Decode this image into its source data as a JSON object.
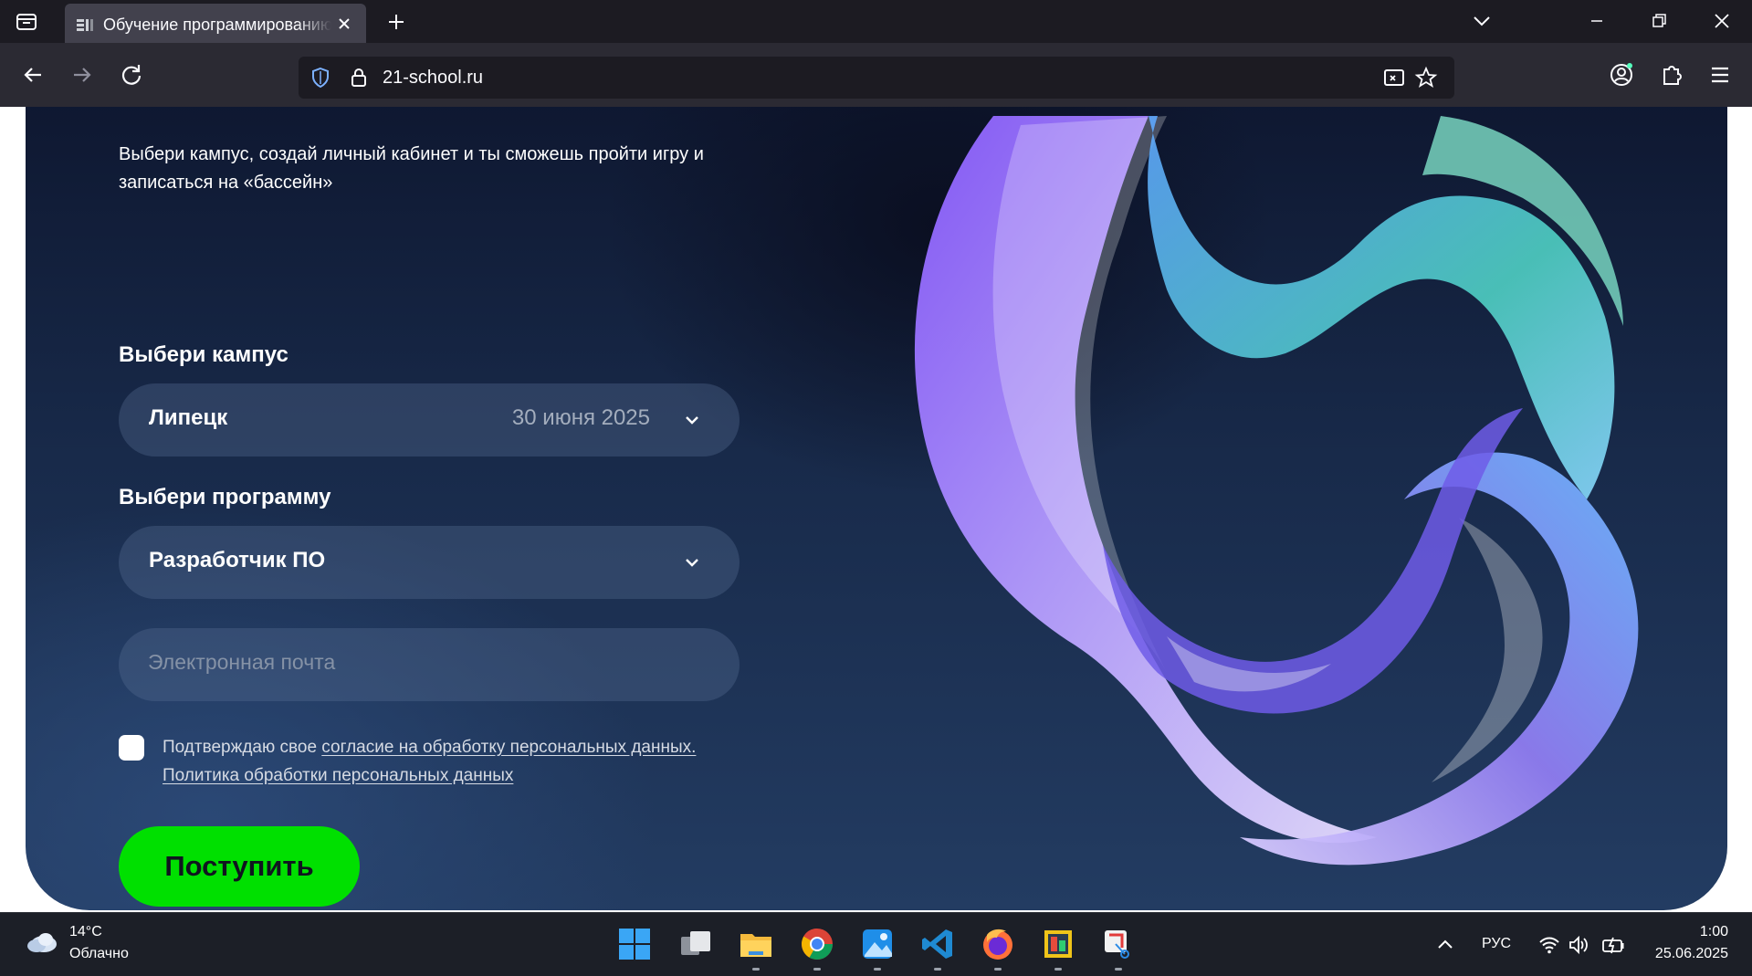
{
  "browser": {
    "tab_title": "Обучение программированию",
    "url": "21-school.ru"
  },
  "page": {
    "intro": "Выбери кампус, создай личный кабинет и ты сможешь пройти игру и записаться на «бассейн»",
    "campus_label": "Выбери кампус",
    "campus_value": "Липецк",
    "campus_date": "30 июня 2025",
    "program_label": "Выбери программу",
    "program_value": "Разработчик ПО",
    "email_placeholder": "Электронная почта",
    "consent_prefix": "Подтверждаю свое ",
    "consent_link": "согласие на обработку персональных данных.",
    "policy_link": "Политика обработки персональных данных",
    "submit_label": "Поступить",
    "checkbox_checked": false
  },
  "color_chip": {
    "hex_label": "273f60",
    "color": "#273f60"
  },
  "colors": {
    "accent_green": "#00e000",
    "page_bg": "#1a2d4c"
  },
  "taskbar": {
    "weather_temp": "14°C",
    "weather_desc": "Облачно",
    "apps": [
      "start-icon",
      "task-view-icon",
      "file-explorer-icon",
      "chrome-icon",
      "photos-icon",
      "vscode-icon",
      "firefox-icon",
      "app-icon",
      "snipping-tool-icon"
    ],
    "language": "РУС",
    "time": "1:00",
    "date": "25.06.2025"
  }
}
